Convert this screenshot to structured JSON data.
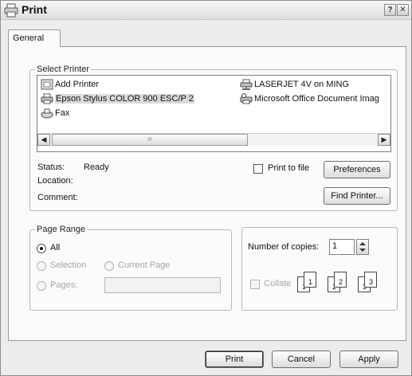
{
  "window": {
    "title": "Print",
    "help_label": "?",
    "close_label": "✕"
  },
  "tabs": [
    {
      "label": "General",
      "selected": true
    }
  ],
  "select_printer": {
    "legend": "Select Printer",
    "printers": [
      {
        "name": "Add Printer",
        "icon": "add-printer-icon"
      },
      {
        "name": "Epson Stylus COLOR 900 ESC/P 2",
        "icon": "printer-icon",
        "selected": true
      },
      {
        "name": "Fax",
        "icon": "fax-icon"
      },
      {
        "name": "LASERJET 4V on MING",
        "icon": "network-printer-icon"
      },
      {
        "name": "Microsoft Office Document Imag",
        "icon": "document-imaging-printer-icon"
      }
    ],
    "scroll_grip": "III",
    "status_label": "Status:",
    "status_value": "Ready",
    "location_label": "Location:",
    "location_value": "",
    "comment_label": "Comment:",
    "comment_value": "",
    "print_to_file_label": "Print to file",
    "print_to_file_checked": false,
    "preferences_label": "Preferences",
    "find_printer_label": "Find Printer..."
  },
  "page_range": {
    "legend": "Page Range",
    "all_label": "All",
    "selection_label": "Selection",
    "current_page_label": "Current Page",
    "pages_label": "Pages:",
    "pages_value": "",
    "selected": "all"
  },
  "copies": {
    "number_label": "Number of copies:",
    "number_value": "1",
    "collate_label": "Collate",
    "collate_checked": false,
    "collate_sets": [
      [
        "1",
        "1"
      ],
      [
        "2",
        "2"
      ],
      [
        "3",
        "3"
      ]
    ]
  },
  "footer": {
    "print_label": "Print",
    "cancel_label": "Cancel",
    "apply_label": "Apply"
  }
}
